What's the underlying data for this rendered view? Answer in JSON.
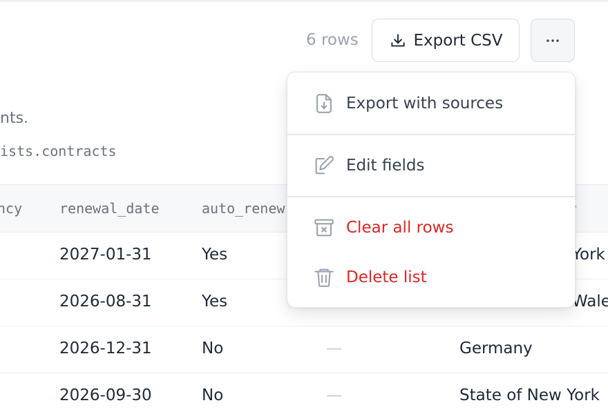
{
  "toolbar": {
    "row_count": "6 rows",
    "export_label": "Export CSV",
    "export_icon": "download-icon",
    "more_icon": "more-horizontal-icon"
  },
  "description": {
    "text": "nts.",
    "source": "ists.contracts"
  },
  "table": {
    "columns": [
      "ncy",
      "renewal_date",
      "auto_renew",
      "",
      "w"
    ],
    "rows": [
      [
        "2027-01-31",
        "Yes",
        "",
        "York"
      ],
      [
        "2026-08-31",
        "Yes",
        "",
        "Wale"
      ],
      [
        "2026-12-31",
        "No",
        "—",
        "Germany"
      ],
      [
        "2026-09-30",
        "No",
        "—",
        "State of New York"
      ]
    ]
  },
  "menu": {
    "items": [
      {
        "label": "Export with sources",
        "icon": "file-download-icon",
        "danger": false
      },
      {
        "label": "Edit fields",
        "icon": "pencil-icon",
        "danger": false
      },
      {
        "label": "Clear all rows",
        "icon": "archive-x-icon",
        "danger": true
      },
      {
        "label": "Delete list",
        "icon": "trash-icon",
        "danger": true
      }
    ]
  },
  "colors": {
    "danger": "#dc2626",
    "text": "#1f2937",
    "muted": "#6b7280",
    "border": "#d9dce2"
  }
}
